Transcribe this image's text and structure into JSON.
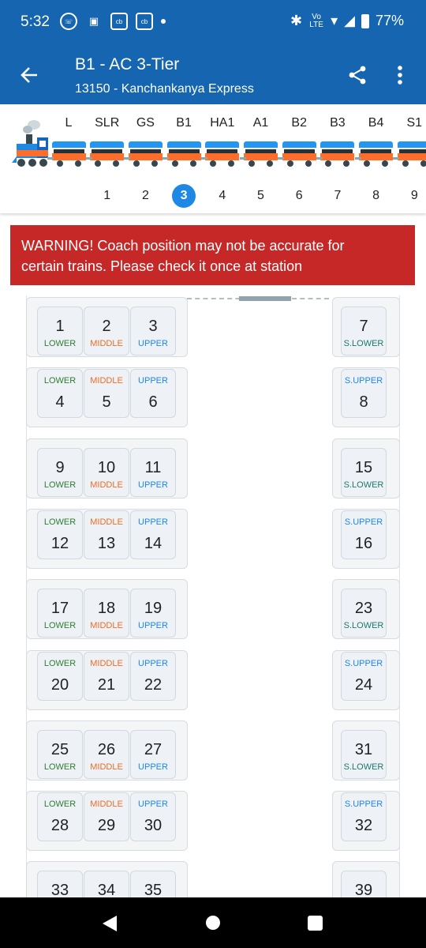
{
  "status": {
    "time": "5:32",
    "net": "Vo LTE",
    "battery": "77%"
  },
  "appbar": {
    "title": "B1 - AC 3-Tier",
    "subtitle": "13150 - Kanchankanya Express"
  },
  "coaches": [
    {
      "name": "L",
      "num": ""
    },
    {
      "name": "SLR",
      "num": "1"
    },
    {
      "name": "GS",
      "num": "2"
    },
    {
      "name": "B1",
      "num": "3"
    },
    {
      "name": "HA1",
      "num": "4"
    },
    {
      "name": "A1",
      "num": "5"
    },
    {
      "name": "B2",
      "num": "6"
    },
    {
      "name": "B3",
      "num": "7"
    },
    {
      "name": "B4",
      "num": "8"
    },
    {
      "name": "S1",
      "num": "9"
    }
  ],
  "active_coach_index": 3,
  "warning": {
    "line1": "WARNING! Coach position may not be accurate for",
    "line2": "certain trains. Please check it once at station"
  },
  "bays": [
    {
      "label_pos": "bottom",
      "main": [
        {
          "n": "1",
          "t": "LOWER"
        },
        {
          "n": "2",
          "t": "MIDDLE"
        },
        {
          "n": "3",
          "t": "UPPER"
        }
      ],
      "side": {
        "n": "7",
        "t": "S.LOWER"
      }
    },
    {
      "label_pos": "top",
      "main": [
        {
          "n": "4",
          "t": "LOWER"
        },
        {
          "n": "5",
          "t": "MIDDLE"
        },
        {
          "n": "6",
          "t": "UPPER"
        }
      ],
      "side": {
        "n": "8",
        "t": "S.UPPER"
      }
    },
    {
      "label_pos": "bottom",
      "main": [
        {
          "n": "9",
          "t": "LOWER"
        },
        {
          "n": "10",
          "t": "MIDDLE"
        },
        {
          "n": "11",
          "t": "UPPER"
        }
      ],
      "side": {
        "n": "15",
        "t": "S.LOWER"
      }
    },
    {
      "label_pos": "top",
      "main": [
        {
          "n": "12",
          "t": "LOWER"
        },
        {
          "n": "13",
          "t": "MIDDLE"
        },
        {
          "n": "14",
          "t": "UPPER"
        }
      ],
      "side": {
        "n": "16",
        "t": "S.UPPER"
      }
    },
    {
      "label_pos": "bottom",
      "main": [
        {
          "n": "17",
          "t": "LOWER"
        },
        {
          "n": "18",
          "t": "MIDDLE"
        },
        {
          "n": "19",
          "t": "UPPER"
        }
      ],
      "side": {
        "n": "23",
        "t": "S.LOWER"
      }
    },
    {
      "label_pos": "top",
      "main": [
        {
          "n": "20",
          "t": "LOWER"
        },
        {
          "n": "21",
          "t": "MIDDLE"
        },
        {
          "n": "22",
          "t": "UPPER"
        }
      ],
      "side": {
        "n": "24",
        "t": "S.UPPER"
      }
    },
    {
      "label_pos": "bottom",
      "main": [
        {
          "n": "25",
          "t": "LOWER"
        },
        {
          "n": "26",
          "t": "MIDDLE"
        },
        {
          "n": "27",
          "t": "UPPER"
        }
      ],
      "side": {
        "n": "31",
        "t": "S.LOWER"
      }
    },
    {
      "label_pos": "top",
      "main": [
        {
          "n": "28",
          "t": "LOWER"
        },
        {
          "n": "29",
          "t": "MIDDLE"
        },
        {
          "n": "30",
          "t": "UPPER"
        }
      ],
      "side": {
        "n": "32",
        "t": "S.UPPER"
      }
    },
    {
      "label_pos": "bottom",
      "main": [
        {
          "n": "33",
          "t": ""
        },
        {
          "n": "34",
          "t": ""
        },
        {
          "n": "35",
          "t": ""
        }
      ],
      "side": {
        "n": "39",
        "t": ""
      }
    }
  ],
  "icons": {
    "back": "arrow-left-icon",
    "share": "share-icon",
    "more": "more-vert-icon"
  },
  "colors": {
    "primary": "#1565b0",
    "warning": "#c62828",
    "active": "#1e88e5"
  }
}
